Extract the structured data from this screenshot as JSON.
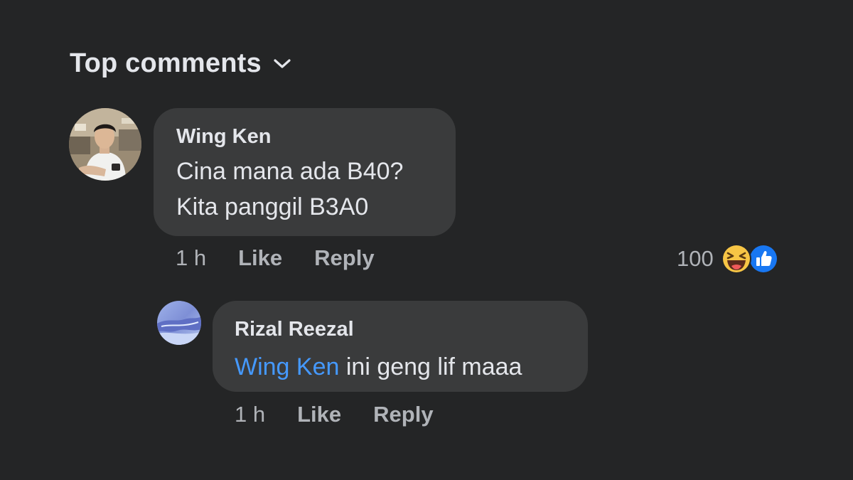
{
  "header": {
    "sort_label": "Top comments",
    "sort_icon": "chevron-down-icon"
  },
  "comments": [
    {
      "author": "Wing Ken",
      "lines": [
        "Cina mana ada B40?",
        "Kita panggil B3A0"
      ],
      "time": "1 h",
      "like_label": "Like",
      "reply_label": "Reply",
      "reactions": {
        "count": "100",
        "icons": [
          "laugh-reaction-icon",
          "like-reaction-icon"
        ]
      },
      "replies": [
        {
          "author": "Rizal Reezal",
          "mention": "Wing Ken",
          "text": " ini geng lif maaa",
          "time": "1 h",
          "like_label": "Like",
          "reply_label": "Reply"
        }
      ]
    }
  ],
  "colors": {
    "background": "#242526",
    "bubble": "#3a3b3c",
    "primary_text": "#e4e6eb",
    "secondary_text": "#b0b3b8",
    "mention": "#4599ff",
    "like_blue": "#1877f2",
    "laugh_yellow": "#f7c545"
  }
}
